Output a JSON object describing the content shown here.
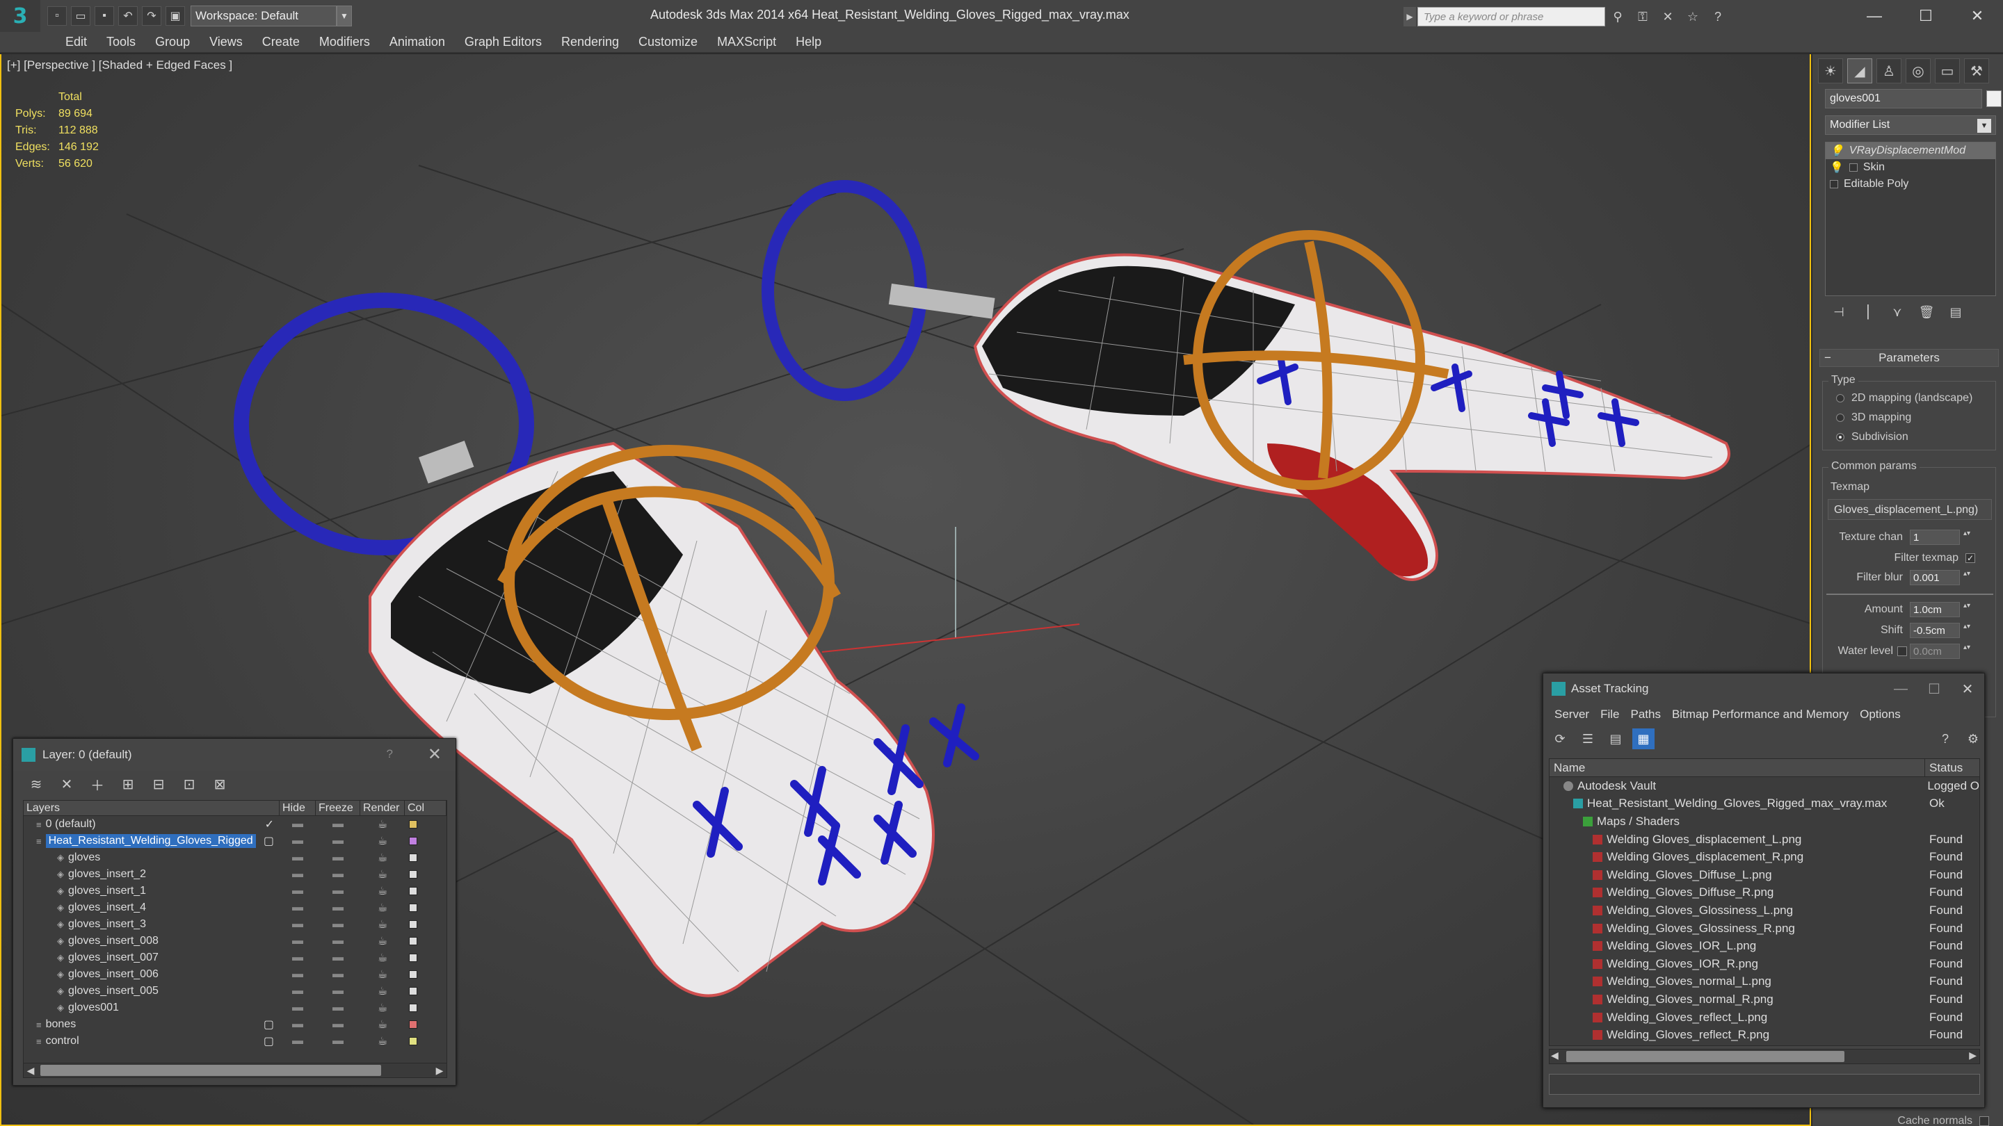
{
  "app": {
    "title": "Autodesk 3ds Max  2014 x64     Heat_Resistant_Welding_Gloves_Rigged_max_vray.max",
    "workspace": "Workspace: Default",
    "search_placeholder": "Type a keyword or phrase"
  },
  "menu": [
    "Edit",
    "Tools",
    "Group",
    "Views",
    "Create",
    "Modifiers",
    "Animation",
    "Graph Editors",
    "Rendering",
    "Customize",
    "MAXScript",
    "Help"
  ],
  "viewport": {
    "label": "[+] [Perspective ] [Shaded + Edged Faces ]",
    "stats_header": "Total",
    "stats": [
      {
        "k": "Polys:",
        "v": "89 694"
      },
      {
        "k": "Tris:",
        "v": "112 888"
      },
      {
        "k": "Edges:",
        "v": "146 192"
      },
      {
        "k": "Verts:",
        "v": "56 620"
      }
    ]
  },
  "layer_panel": {
    "title": "Layer: 0 (default)",
    "help": "?",
    "columns": [
      "Layers",
      "Hide",
      "Freeze",
      "Render",
      "Col"
    ],
    "rows": [
      {
        "name": "0 (default)",
        "indent": 0,
        "check": "✓",
        "color": "#e0c060"
      },
      {
        "name": "Heat_Resistant_Welding_Gloves_Rigged",
        "indent": 0,
        "selected": true,
        "check": "▢",
        "color": "#c080e0"
      },
      {
        "name": "gloves",
        "indent": 1,
        "color": "#dddddd"
      },
      {
        "name": "gloves_insert_2",
        "indent": 1,
        "color": "#dddddd"
      },
      {
        "name": "gloves_insert_1",
        "indent": 1,
        "color": "#dddddd"
      },
      {
        "name": "gloves_insert_4",
        "indent": 1,
        "color": "#dddddd"
      },
      {
        "name": "gloves_insert_3",
        "indent": 1,
        "color": "#dddddd"
      },
      {
        "name": "gloves_insert_008",
        "indent": 1,
        "color": "#dddddd"
      },
      {
        "name": "gloves_insert_007",
        "indent": 1,
        "color": "#dddddd"
      },
      {
        "name": "gloves_insert_006",
        "indent": 1,
        "color": "#dddddd"
      },
      {
        "name": "gloves_insert_005",
        "indent": 1,
        "color": "#dddddd"
      },
      {
        "name": "gloves001",
        "indent": 1,
        "color": "#dddddd"
      },
      {
        "name": "bones",
        "indent": 0,
        "check": "▢",
        "color": "#e07070"
      },
      {
        "name": "control",
        "indent": 0,
        "check": "▢",
        "color": "#e0e080"
      }
    ]
  },
  "command_panel": {
    "object_name": "gloves001",
    "modifier_list": "Modifier List",
    "stack": [
      "VRayDisplacementMod",
      "Skin",
      "Editable Poly"
    ],
    "rollout_title": "Parameters",
    "type_label": "Type",
    "type_options": [
      "2D mapping (landscape)",
      "3D mapping",
      "Subdivision"
    ],
    "common_params": "Common params",
    "texmap_label": "Texmap",
    "texmap_value": "Gloves_displacement_L.png)",
    "texture_chan_label": "Texture chan",
    "texture_chan": "1",
    "filter_texmap_label": "Filter texmap",
    "filter_blur_label": "Filter blur",
    "filter_blur": "0.001",
    "amount_label": "Amount",
    "amount": "1.0cm",
    "shift_label": "Shift",
    "shift": "-0.5cm",
    "water_level_label": "Water level",
    "water_level": "0.0cm",
    "cache_normals": "Cache normals"
  },
  "asset_tracking": {
    "title": "Asset Tracking",
    "menu": [
      "Server",
      "File",
      "Paths",
      "Bitmap Performance and Memory",
      "Options"
    ],
    "col_name": "Name",
    "col_status": "Status",
    "rows": [
      {
        "name": "Autodesk Vault",
        "status": "Logged O",
        "indent": 1,
        "icon": "vault"
      },
      {
        "name": "Heat_Resistant_Welding_Gloves_Rigged_max_vray.max",
        "status": "Ok",
        "indent": 2,
        "icon": "max"
      },
      {
        "name": "Maps / Shaders",
        "status": "",
        "indent": 3,
        "icon": "folder"
      },
      {
        "name": "Welding Gloves_displacement_L.png",
        "status": "Found",
        "indent": 4,
        "icon": "png"
      },
      {
        "name": "Welding Gloves_displacement_R.png",
        "status": "Found",
        "indent": 4,
        "icon": "png"
      },
      {
        "name": "Welding_Gloves_Diffuse_L.png",
        "status": "Found",
        "indent": 4,
        "icon": "png"
      },
      {
        "name": "Welding_Gloves_Diffuse_R.png",
        "status": "Found",
        "indent": 4,
        "icon": "png"
      },
      {
        "name": "Welding_Gloves_Glossiness_L.png",
        "status": "Found",
        "indent": 4,
        "icon": "png"
      },
      {
        "name": "Welding_Gloves_Glossiness_R.png",
        "status": "Found",
        "indent": 4,
        "icon": "png"
      },
      {
        "name": "Welding_Gloves_IOR_L.png",
        "status": "Found",
        "indent": 4,
        "icon": "png"
      },
      {
        "name": "Welding_Gloves_IOR_R.png",
        "status": "Found",
        "indent": 4,
        "icon": "png"
      },
      {
        "name": "Welding_Gloves_normal_L.png",
        "status": "Found",
        "indent": 4,
        "icon": "png"
      },
      {
        "name": "Welding_Gloves_normal_R.png",
        "status": "Found",
        "indent": 4,
        "icon": "png"
      },
      {
        "name": "Welding_Gloves_reflect_L.png",
        "status": "Found",
        "indent": 4,
        "icon": "png"
      },
      {
        "name": "Welding_Gloves_reflect_R.png",
        "status": "Found",
        "indent": 4,
        "icon": "png"
      }
    ]
  }
}
